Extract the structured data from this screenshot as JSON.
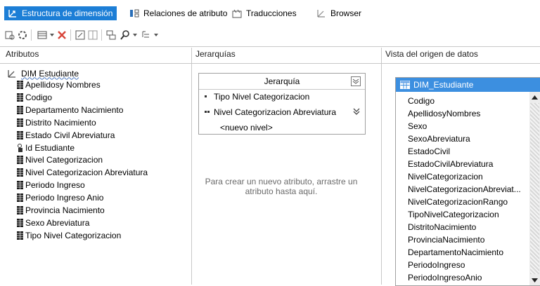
{
  "tabs": [
    {
      "label": "Estructura de dimensión",
      "active": true
    },
    {
      "label": "Relaciones de atributo",
      "active": false
    },
    {
      "label": "Traducciones",
      "active": false
    },
    {
      "label": "Browser",
      "active": false
    }
  ],
  "panes": {
    "attributes_header": "Atributos",
    "hierarchies_header": "Jerarquías",
    "dsv_header": "Vista del origen de datos"
  },
  "dimension": {
    "name": "DIM Estudiante",
    "attributes": [
      "Apellidosy Nombres",
      "Codigo",
      "Departamento Nacimiento",
      "Distrito Nacimiento",
      "Estado Civil Abreviatura",
      "Id Estudiante",
      "Nivel Categorizacion",
      "Nivel Categorizacion Abreviatura",
      "Periodo Ingreso",
      "Periodo Ingreso Anio",
      "Provincia Nacimiento",
      "Sexo Abreviatura",
      "Tipo Nivel Categorizacion"
    ]
  },
  "hierarchy": {
    "title": "Jerarquía",
    "levels": [
      "Tipo Nivel Categorizacion",
      "Nivel Categorizacion Abreviatura"
    ],
    "new_level": "<nuevo nivel>",
    "drop_hint": "Para crear un nuevo atributo, arrastre un atributo hasta aquí."
  },
  "dsv": {
    "table": "DIM_Estudiante",
    "columns": [
      "Codigo",
      "ApellidosyNombres",
      "Sexo",
      "SexoAbreviatura",
      "EstadoCivil",
      "EstadoCivilAbreviatura",
      "NivelCategorizacion",
      "NivelCategorizacionAbreviat...",
      "NivelCategorizacionRango",
      "TipoNivelCategorizacion",
      "DistritoNacimiento",
      "ProvinciaNacimiento",
      "DepartamentoNacimiento",
      "PeriodoIngreso",
      "PeriodoIngresoAnio"
    ]
  },
  "colors": {
    "accent": "#1c7ed6",
    "table_header": "#3c8fe0"
  }
}
